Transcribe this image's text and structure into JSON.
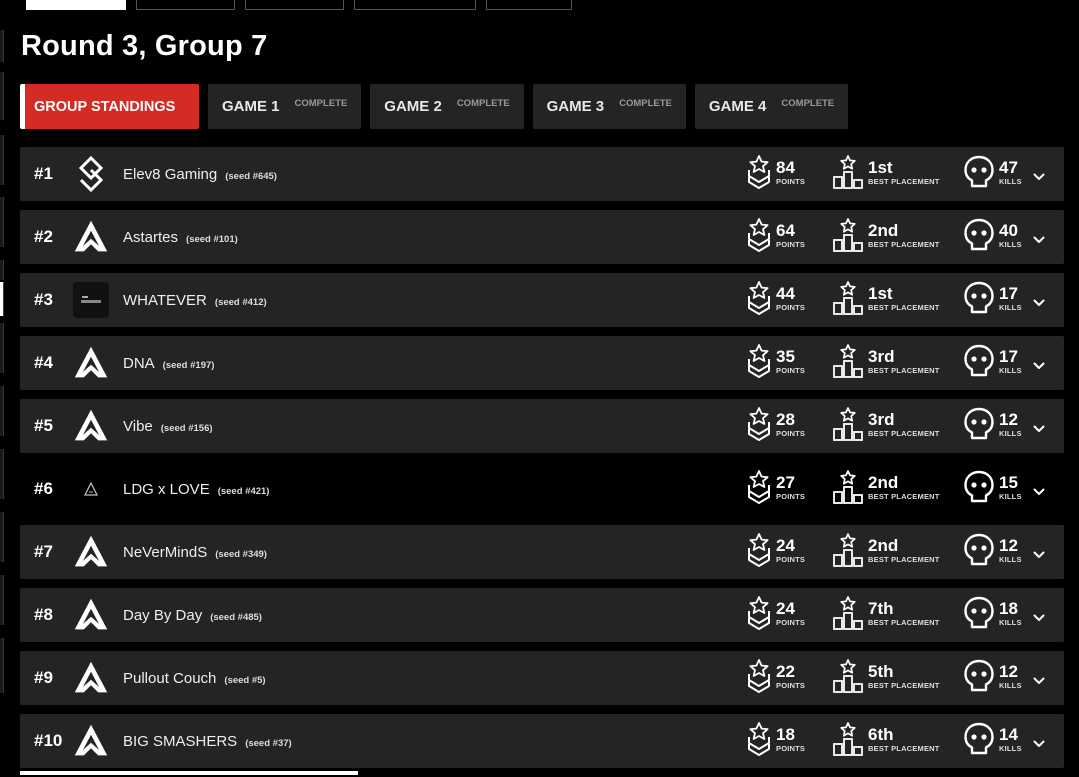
{
  "header": {
    "title": "Round 3, Group 7"
  },
  "tabs": [
    {
      "label": "GROUP STANDINGS",
      "status": "",
      "active": true
    },
    {
      "label": "GAME 1",
      "status": "COMPLETE",
      "active": false
    },
    {
      "label": "GAME 2",
      "status": "COMPLETE",
      "active": false
    },
    {
      "label": "GAME 3",
      "status": "COMPLETE",
      "active": false
    },
    {
      "label": "GAME 4",
      "status": "COMPLETE",
      "active": false
    }
  ],
  "stat_labels": {
    "points": "POINTS",
    "best_placement": "BEST PLACEMENT",
    "kills": "KILLS"
  },
  "standings": [
    {
      "rank": "#1",
      "team": "Elev8 Gaming",
      "seed": "(seed #645)",
      "logo": "elev8-logo",
      "points": "84",
      "best_placement": "1st",
      "kills": "47"
    },
    {
      "rank": "#2",
      "team": "Astartes",
      "seed": "(seed #101)",
      "logo": "apex-logo",
      "points": "64",
      "best_placement": "2nd",
      "kills": "40"
    },
    {
      "rank": "#3",
      "team": "WHATEVER",
      "seed": "(seed #412)",
      "logo": "whatever-logo",
      "points": "44",
      "best_placement": "1st",
      "kills": "17"
    },
    {
      "rank": "#4",
      "team": "DNA",
      "seed": "(seed #197)",
      "logo": "apex-logo",
      "points": "35",
      "best_placement": "3rd",
      "kills": "17"
    },
    {
      "rank": "#5",
      "team": "Vibe",
      "seed": "(seed #156)",
      "logo": "apex-logo",
      "points": "28",
      "best_placement": "3rd",
      "kills": "12"
    },
    {
      "rank": "#6",
      "team": "LDG x LOVE",
      "seed": "(seed #421)",
      "logo": "ldg-logo",
      "points": "27",
      "best_placement": "2nd",
      "kills": "15"
    },
    {
      "rank": "#7",
      "team": "NeVerMindS",
      "seed": "(seed #349)",
      "logo": "apex-logo",
      "points": "24",
      "best_placement": "2nd",
      "kills": "12"
    },
    {
      "rank": "#8",
      "team": "Day By Day",
      "seed": "(seed #485)",
      "logo": "apex-logo",
      "points": "24",
      "best_placement": "7th",
      "kills": "18"
    },
    {
      "rank": "#9",
      "team": "Pullout Couch",
      "seed": "(seed #5)",
      "logo": "apex-logo",
      "points": "22",
      "best_placement": "5th",
      "kills": "12"
    },
    {
      "rank": "#10",
      "team": "BIG SMASHERS",
      "seed": "(seed #37)",
      "logo": "apex-logo",
      "points": "18",
      "best_placement": "6th",
      "kills": "14"
    }
  ],
  "colors": {
    "accent": "#d42b24",
    "row_bg": "#242424",
    "page_bg": "#000000"
  }
}
